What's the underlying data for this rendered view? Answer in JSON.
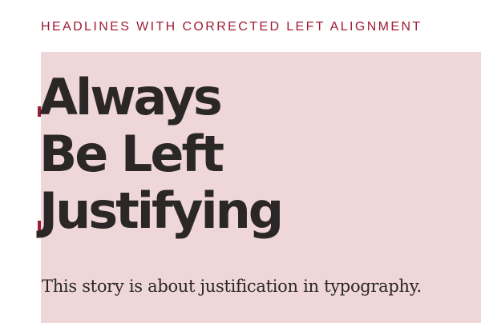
{
  "eyebrow": "HEADLINES WITH CORRECTED LEFT ALIGNMENT",
  "headline": {
    "lines": [
      "Always",
      "Be Left",
      "Justifying"
    ]
  },
  "deck": "This story is about justification in typography.",
  "colors": {
    "accent": "#9e1b35",
    "panel": "#efd6d8",
    "text": "#2b2727"
  }
}
